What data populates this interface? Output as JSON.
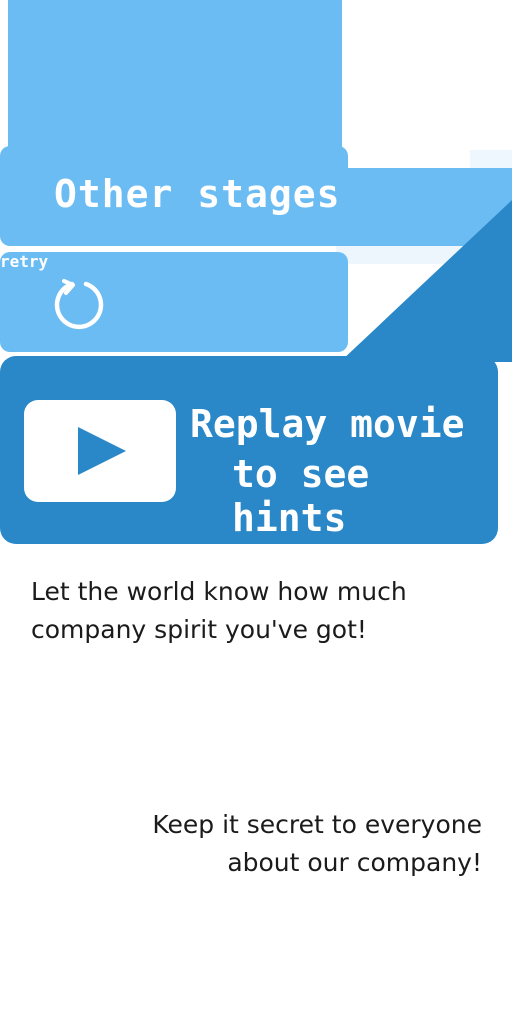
{
  "menu": {
    "other_stages_label": "Other stages",
    "retry_label": "retry",
    "replay_line1": "Replay movie",
    "replay_line2": "to see hints"
  },
  "messages": {
    "line1": "Let the world know how much",
    "line2": "company spirit you've got!",
    "line3": "Keep it secret to everyone",
    "line4": "about our company!"
  },
  "icons": {
    "retry": "retry-icon",
    "play": "play-icon"
  },
  "colors": {
    "light_blue": "#6bbcf3",
    "dark_blue": "#2a87c8",
    "text_dark": "#1b1b1b",
    "white": "#ffffff"
  }
}
